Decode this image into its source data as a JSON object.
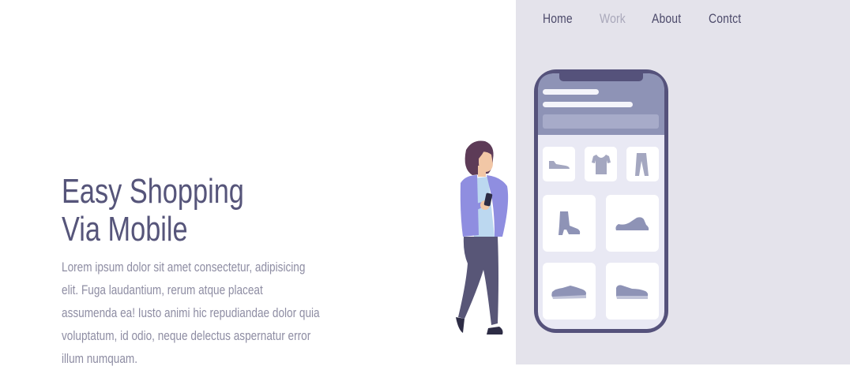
{
  "nav": {
    "items": [
      {
        "label": "Home",
        "active": false
      },
      {
        "label": "Work",
        "active": true
      },
      {
        "label": "About",
        "active": false
      },
      {
        "label": "Contct",
        "active": false
      }
    ]
  },
  "hero": {
    "title_line1": "Easy Shopping",
    "title_line2": "Via Mobile",
    "body_lines": [
      "Lorem ipsum dolor sit amet consectetur, adipisicing",
      "elit. Fuga laudantium, rerum atque placeat",
      "assumenda ea! Iusto animi hic repudiandae dolor quia",
      "voluptatum, id odio, neque delectus aspernatur error",
      "illum numquam."
    ]
  },
  "illustration": {
    "phone_products": [
      "shoe-flat-icon",
      "tshirt-icon",
      "pants-icon",
      "boot-icon",
      "sneaker-icon",
      "loafer-icon",
      "slip-on-icon"
    ]
  },
  "colors": {
    "panel": "#e4e3eb",
    "title": "#56557a",
    "body": "#8e8da3",
    "nav": "#4c4a6a",
    "nav_active": "#a9a8ba",
    "phone_frame": "#55527b",
    "phone_header": "#8e93b6"
  }
}
